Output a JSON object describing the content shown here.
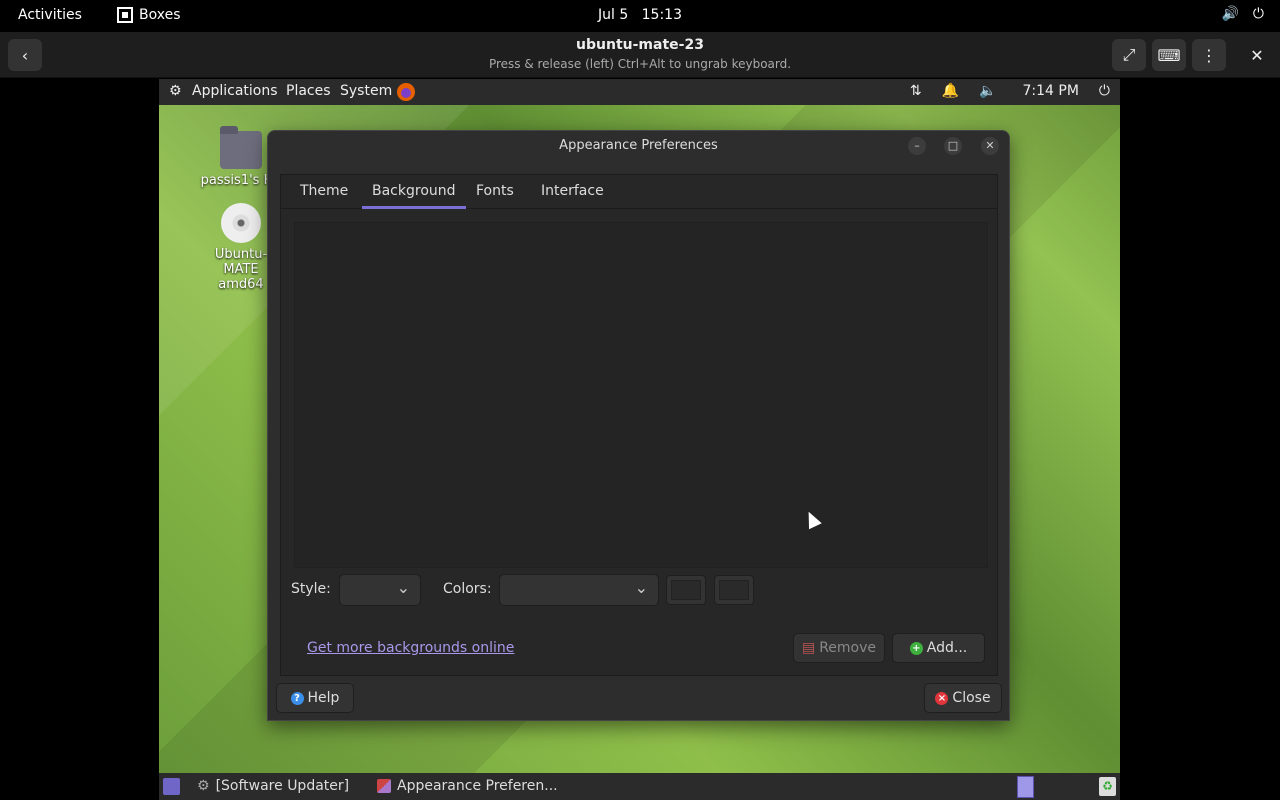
{
  "gnome": {
    "activities": "Activities",
    "app_name": "Boxes",
    "date": "Jul 5",
    "time": "15:13"
  },
  "boxes_header": {
    "title": "ubuntu-mate-23",
    "subtitle": "Press & release (left) Ctrl+Alt to ungrab keyboard."
  },
  "mate_panel": {
    "applications": "Applications",
    "places": "Places",
    "system": "System",
    "clock": "7:14 PM"
  },
  "desktop_icons": [
    {
      "label": "passis1's Ho"
    },
    {
      "label": "Ubuntu-MATE amd64"
    }
  ],
  "dialog": {
    "title": "Appearance Preferences",
    "tabs": [
      {
        "label": "Theme"
      },
      {
        "label": "Background"
      },
      {
        "label": "Fonts"
      },
      {
        "label": "Interface"
      }
    ],
    "active_tab": "Background",
    "style_label": "Style:",
    "colors_label": "Colors:",
    "get_more_link": "Get more backgrounds online",
    "remove_button": "Remove",
    "add_button": "Add...",
    "help_button": "Help",
    "close_button": "Close"
  },
  "taskbar": {
    "items": [
      {
        "label": "[Software Updater]"
      },
      {
        "label": "Appearance Preferen..."
      }
    ]
  },
  "colors": {
    "accent": "#7a6fd4",
    "link": "#a998ea",
    "add_green": "#3db03d",
    "close_red": "#e0353a",
    "help_blue": "#3b8eea"
  }
}
